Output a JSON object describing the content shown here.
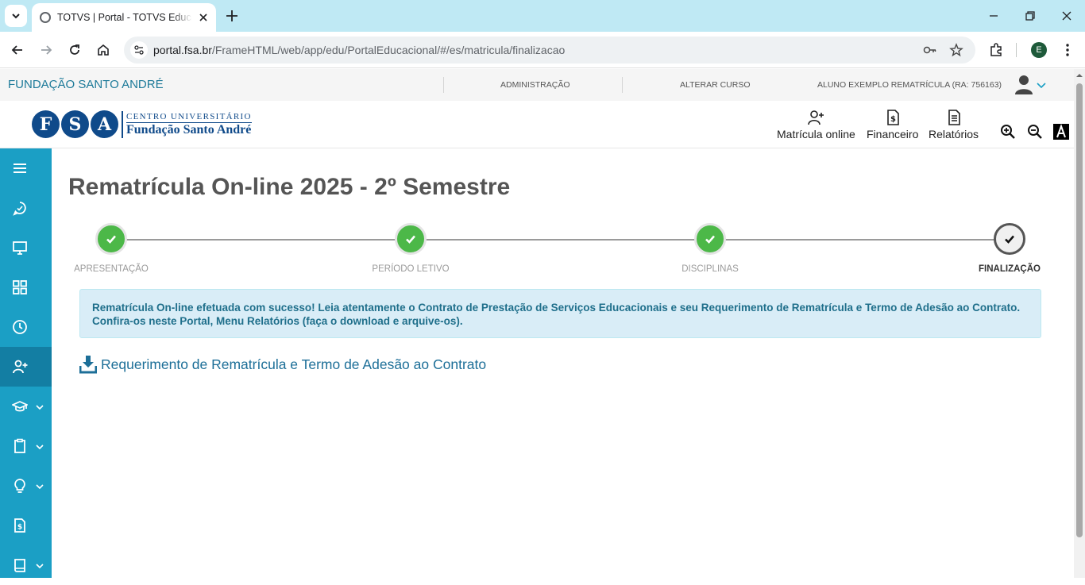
{
  "browser": {
    "tab_title": "TOTVS | Portal - TOTVS Educacional",
    "url_domain": "portal.fsa.br",
    "url_path": "/FrameHTML/web/app/edu/PortalEducacional/#/es/matricula/finalizacao",
    "profile_initial": "E"
  },
  "topbar": {
    "org_name": "FUNDAÇÃO SANTO ANDRÉ",
    "admin_link": "ADMINISTRAÇÃO",
    "change_course_link": "ALTERAR CURSO",
    "user_label": "ALUNO EXEMPLO REMATRÍCULA (RA: 756163)"
  },
  "logo": {
    "letters": [
      "F",
      "S",
      "A"
    ],
    "line1": "CENTRO UNIVERSITÁRIO",
    "line2": "Fundação Santo André"
  },
  "header_nav": {
    "enrollment": "Matrícula online",
    "financial": "Financeiro",
    "reports": "Relatórios"
  },
  "page": {
    "title": "Rematrícula On-line 2025 - 2º Semestre"
  },
  "steps": [
    {
      "label": "APRESENTAÇÃO",
      "status": "done"
    },
    {
      "label": "PERÍODO LETIVO",
      "status": "done"
    },
    {
      "label": "DISCIPLINAS",
      "status": "done"
    },
    {
      "label": "FINALIZAÇÃO",
      "status": "current"
    }
  ],
  "alert": {
    "line1": "Rematrícula On-line efetuada com sucesso! Leia atentamente o Contrato de Prestação de Serviços Educacionais e seu Requerimento de Rematrícula e Termo de Adesão ao Contrato.",
    "line2": "Confira-os neste Portal, Menu Relatórios (faça o download e arquive-os)."
  },
  "download": {
    "label": "Requerimento de Rematrícula e Termo de Adesão ao Contrato"
  },
  "colors": {
    "brand_blue": "#0f4a8a",
    "sidebar": "#1b9fc5",
    "sidebar_active": "#137ea3",
    "step_done": "#4cb848",
    "alert_bg": "#d9edf7",
    "link": "#1d6f98"
  },
  "sidebar_icons": [
    "menu-icon",
    "chat-icon",
    "monitor-icon",
    "grid-icon",
    "clock-icon",
    "user-plus-icon",
    "graduation-cap-icon",
    "clipboard-icon",
    "lightbulb-icon",
    "money-file-icon",
    "book-icon"
  ]
}
